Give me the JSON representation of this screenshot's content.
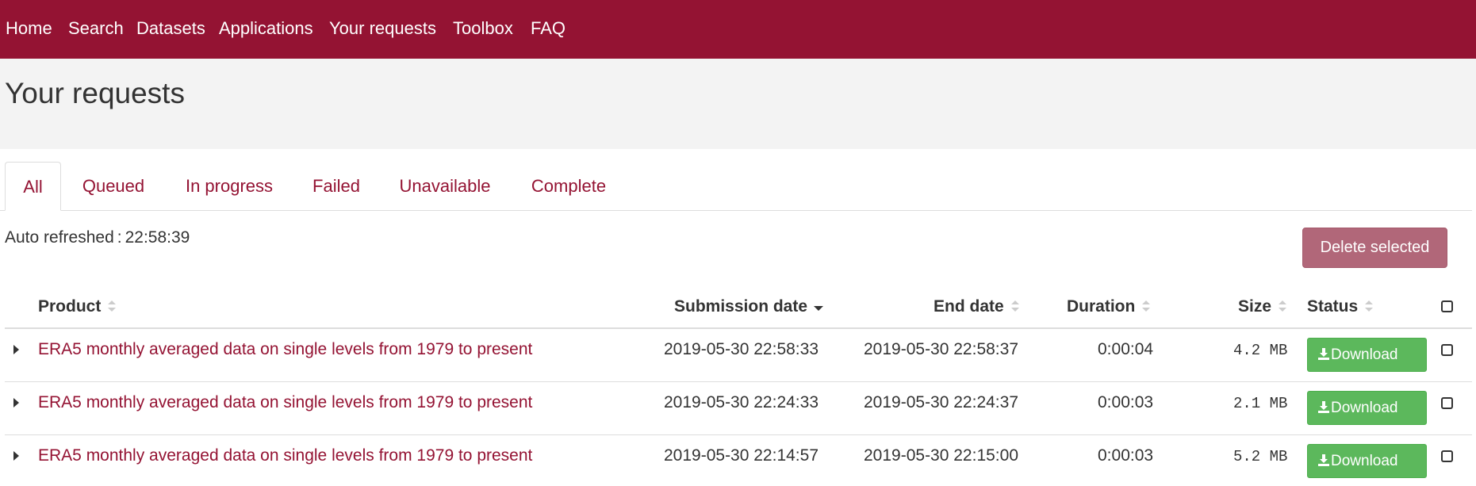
{
  "nav": {
    "items": [
      {
        "label": "Home"
      },
      {
        "label": "Search"
      },
      {
        "label": "Datasets"
      },
      {
        "label": "Applications"
      },
      {
        "label": "Your requests"
      },
      {
        "label": "Toolbox"
      },
      {
        "label": "FAQ"
      }
    ]
  },
  "page": {
    "title": "Your requests"
  },
  "tabs": [
    {
      "label": "All",
      "active": true
    },
    {
      "label": "Queued",
      "active": false
    },
    {
      "label": "In progress",
      "active": false
    },
    {
      "label": "Failed",
      "active": false
    },
    {
      "label": "Unavailable",
      "active": false
    },
    {
      "label": "Complete",
      "active": false
    }
  ],
  "refresh": {
    "label": "Auto refreshed",
    "separator": ":",
    "time": "22:58:39"
  },
  "actions": {
    "delete_label": "Delete selected"
  },
  "table": {
    "columns": {
      "product": "Product",
      "submission_date": "Submission date",
      "end_date": "End date",
      "duration": "Duration",
      "size": "Size",
      "status": "Status"
    },
    "sorted_by": "submission_date",
    "sort_direction": "descending",
    "rows": [
      {
        "product": "ERA5 monthly averaged data on single levels from 1979 to present",
        "submission_date": "2019-05-30 22:58:33",
        "end_date": "2019-05-30 22:58:37",
        "duration": "0:00:04",
        "size": "4.2 MB",
        "status": "Download"
      },
      {
        "product": "ERA5 monthly averaged data on single levels from 1979 to present",
        "submission_date": "2019-05-30 22:24:33",
        "end_date": "2019-05-30 22:24:37",
        "duration": "0:00:03",
        "size": "2.1 MB",
        "status": "Download"
      },
      {
        "product": "ERA5 monthly averaged data on single levels from 1979 to present",
        "submission_date": "2019-05-30 22:14:57",
        "end_date": "2019-05-30 22:15:00",
        "duration": "0:00:03",
        "size": "5.2 MB",
        "status": "Download"
      }
    ]
  },
  "colors": {
    "brand": "#941333",
    "download_button": "#5cb85c",
    "delete_button": "#b16779",
    "title_band": "#f3f3f3"
  },
  "icons": {
    "sort": "sort-icon",
    "sort_active": "sort-desc-icon",
    "download": "download-icon",
    "expand": "caret-right-icon",
    "checkbox": "checkbox-icon"
  }
}
